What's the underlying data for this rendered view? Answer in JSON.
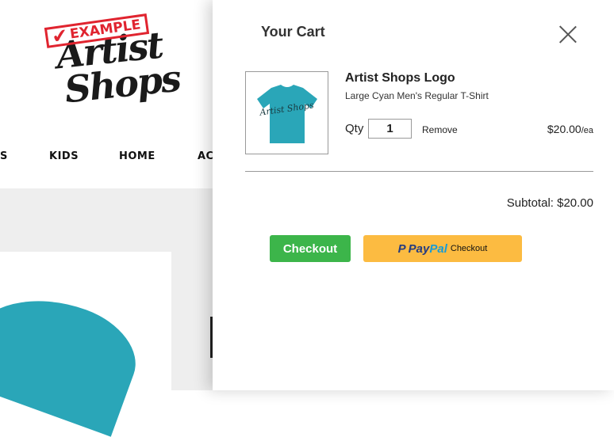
{
  "store": {
    "logo_text_line1": "Artist",
    "logo_text_line2": "Shops",
    "stamp_text": "EXAMPLE",
    "nav": [
      "S",
      "KIDS",
      "HOME",
      "AC"
    ]
  },
  "cart": {
    "title": "Your Cart",
    "close_icon": "close-icon",
    "item": {
      "thumb_text": "Artist Shops",
      "name": "Artist Shops Logo",
      "description": "Large Cyan Men's Regular T-Shirt",
      "qty_label": "Qty",
      "qty_value": "1",
      "remove_label": "Remove",
      "price": "$20.00",
      "price_unit": "/ea",
      "shirt_color": "#2aa6b8"
    },
    "subtotal": "Subtotal: $20.00",
    "checkout_label": "Checkout",
    "paypal": {
      "pay": "Pay",
      "pal": "Pal",
      "label": "Checkout"
    }
  }
}
